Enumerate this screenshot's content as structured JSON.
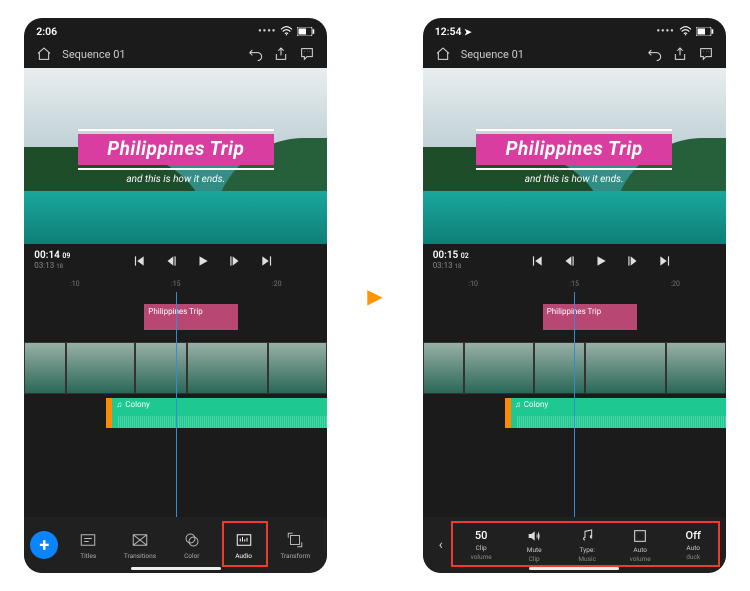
{
  "left": {
    "status_time": "2:06",
    "sequence": "Sequence 01",
    "video_title": "Philippines Trip",
    "video_subtitle": "and this is how it ends.",
    "time_current": "00:14",
    "time_current_frames": "09",
    "time_total": "03:13",
    "time_total_frames": "18",
    "ruler": [
      ":10",
      ":15",
      ":20"
    ],
    "clip_title": "Philippines Trip",
    "audio_clip": "Colony",
    "tools": {
      "titles": "Titles",
      "transitions": "Transitions",
      "color": "Color",
      "audio": "Audio",
      "transform": "Transform"
    }
  },
  "right": {
    "status_time": "12:54",
    "sequence": "Sequence 01",
    "video_title": "Philippines Trip",
    "video_subtitle": "and this is how it ends.",
    "time_current": "00:15",
    "time_current_frames": "02",
    "time_total": "03:13",
    "time_total_frames": "18",
    "ruler": [
      ":10",
      ":15",
      ":20"
    ],
    "clip_title": "Philippines Trip",
    "audio_clip": "Colony",
    "audio_tools": {
      "clip_volume_val": "50",
      "clip_volume_lbl1": "Clip",
      "clip_volume_lbl2": "volume",
      "mute_lbl1": "Mute",
      "mute_lbl2": "Clip",
      "type_lbl1": "Type:",
      "type_lbl2": "Music",
      "auto_vol_lbl1": "Auto",
      "auto_vol_lbl2": "volume",
      "auto_duck_val": "Off",
      "auto_duck_lbl1": "Auto",
      "auto_duck_lbl2": "duck"
    }
  }
}
